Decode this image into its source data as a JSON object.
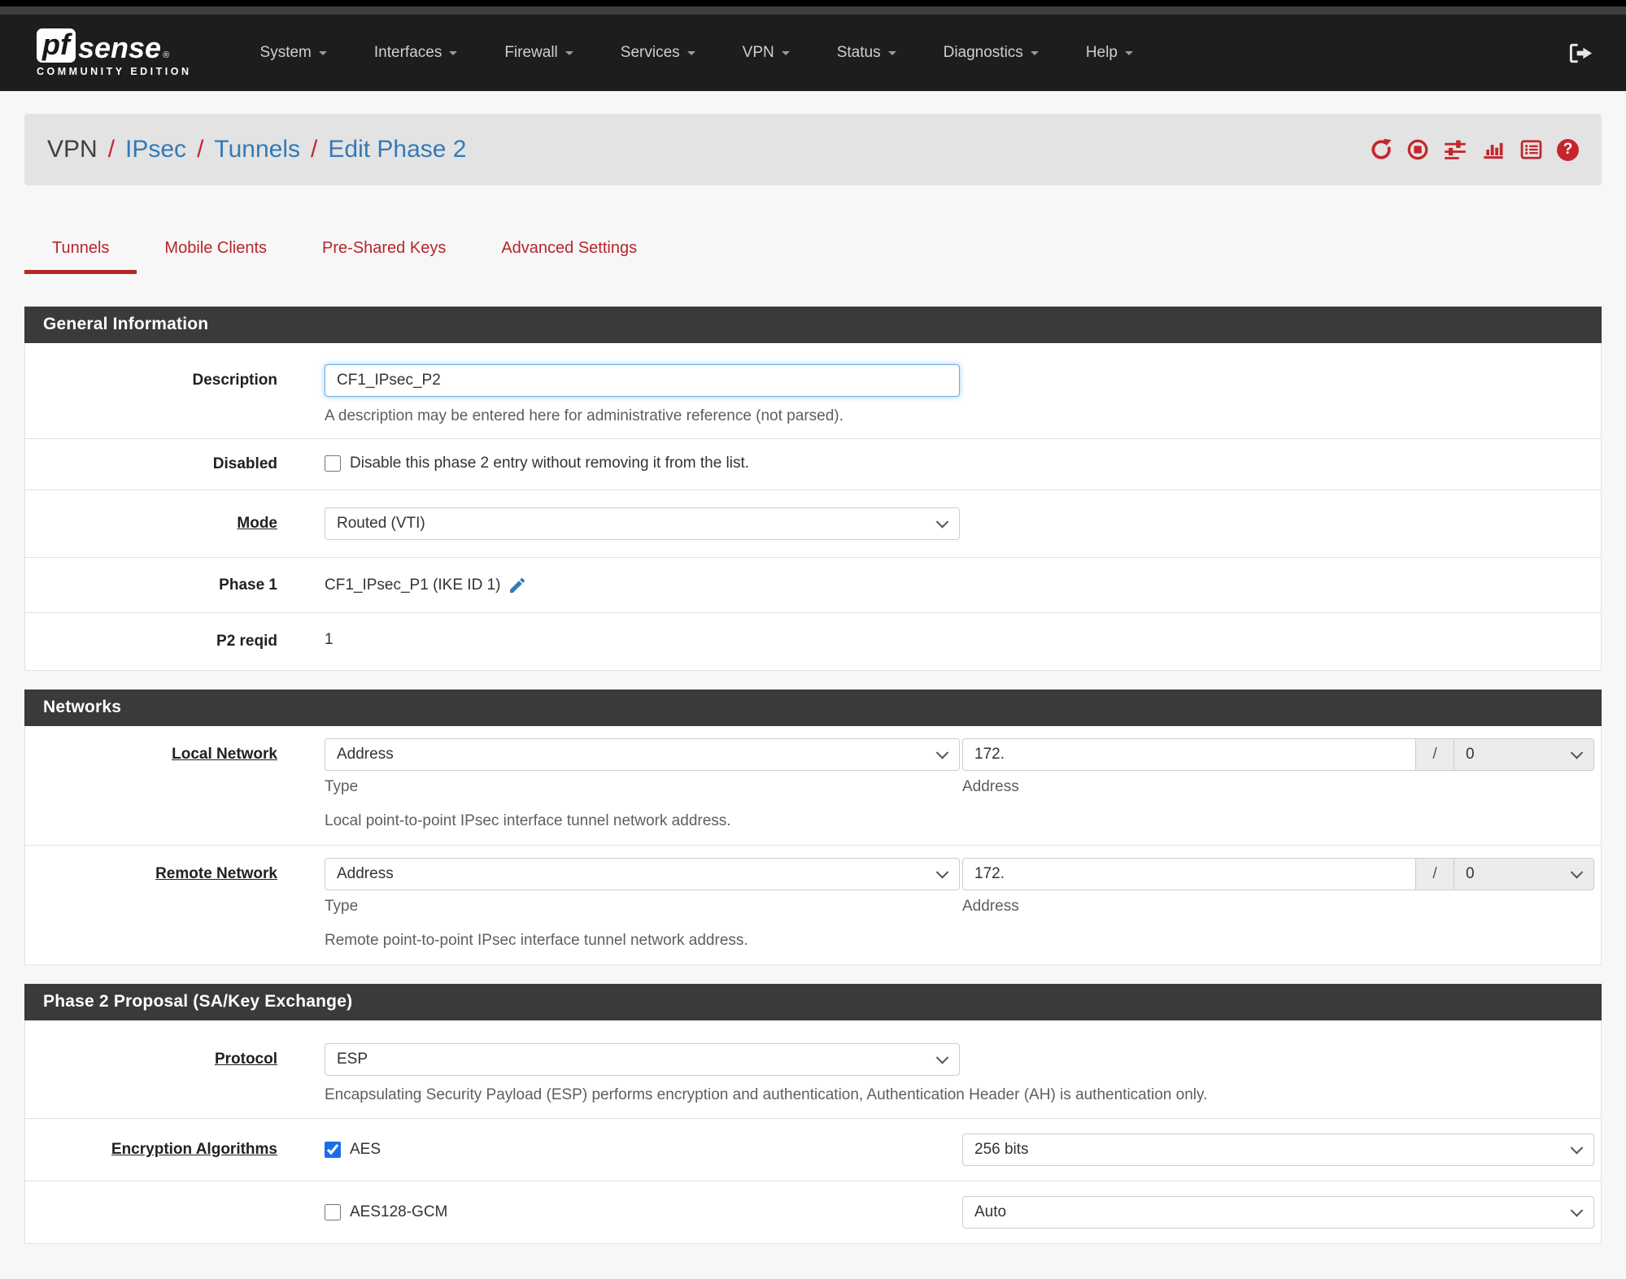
{
  "colors": {
    "accent_red": "#c4262c",
    "link_blue": "#337ab7",
    "navbar_bg": "#1d1d1d",
    "panel_header_bg": "#3a3a3a",
    "checkbox_blue": "#1a6fe8"
  },
  "navbar": {
    "brand": {
      "pf": "pf",
      "sense": "sense",
      "reg": "®",
      "edition": "COMMUNITY EDITION"
    },
    "menus": [
      {
        "label": "System"
      },
      {
        "label": "Interfaces"
      },
      {
        "label": "Firewall"
      },
      {
        "label": "Services"
      },
      {
        "label": "VPN"
      },
      {
        "label": "Status"
      },
      {
        "label": "Diagnostics"
      },
      {
        "label": "Help"
      }
    ],
    "signout_icon": "sign-out-icon"
  },
  "breadcrumb": {
    "section": "VPN",
    "separator": "/",
    "links": [
      "IPsec",
      "Tunnels",
      "Edit Phase 2"
    ],
    "icons": [
      "refresh-icon",
      "stop-icon",
      "sliders-icon",
      "chart-bar-icon",
      "list-icon",
      "help-icon"
    ]
  },
  "tabs": [
    {
      "label": "Tunnels",
      "active": true
    },
    {
      "label": "Mobile Clients",
      "active": false
    },
    {
      "label": "Pre-Shared Keys",
      "active": false
    },
    {
      "label": "Advanced Settings",
      "active": false
    }
  ],
  "panels": {
    "general": {
      "title": "General Information",
      "description": {
        "label": "Description",
        "value": "CF1_IPsec_P2",
        "help": "A description may be entered here for administrative reference (not parsed)."
      },
      "disabled": {
        "label": "Disabled",
        "checkbox_label": "Disable this phase 2 entry without removing it from the list."
      },
      "mode": {
        "label": "Mode",
        "value": "Routed (VTI)"
      },
      "phase1": {
        "label": "Phase 1",
        "value": "CF1_IPsec_P1 (IKE ID 1)",
        "icon": "pencil-icon"
      },
      "p2reqid": {
        "label": "P2 reqid",
        "value": "1"
      }
    },
    "networks": {
      "title": "Networks",
      "local": {
        "label": "Local Network",
        "type_value": "Address",
        "type_caption": "Type",
        "addr_value": "172.",
        "addr_caption": "Address",
        "slash": "/",
        "prefix_value": "0",
        "help": "Local point-to-point IPsec interface tunnel network address."
      },
      "remote": {
        "label": "Remote Network",
        "type_value": "Address",
        "type_caption": "Type",
        "addr_value": "172.",
        "addr_caption": "Address",
        "slash": "/",
        "prefix_value": "0",
        "help": "Remote point-to-point IPsec interface tunnel network address."
      }
    },
    "proposal": {
      "title": "Phase 2 Proposal (SA/Key Exchange)",
      "protocol": {
        "label": "Protocol",
        "value": "ESP",
        "help": "Encapsulating Security Payload (ESP) performs encryption and authentication, Authentication Header (AH) is authentication only."
      },
      "encryption": {
        "label": "Encryption Algorithms",
        "algorithms": [
          {
            "name": "AES",
            "checked": "checked",
            "keylen": "256 bits"
          },
          {
            "name": "AES128-GCM",
            "keylen": "Auto"
          }
        ]
      }
    }
  }
}
